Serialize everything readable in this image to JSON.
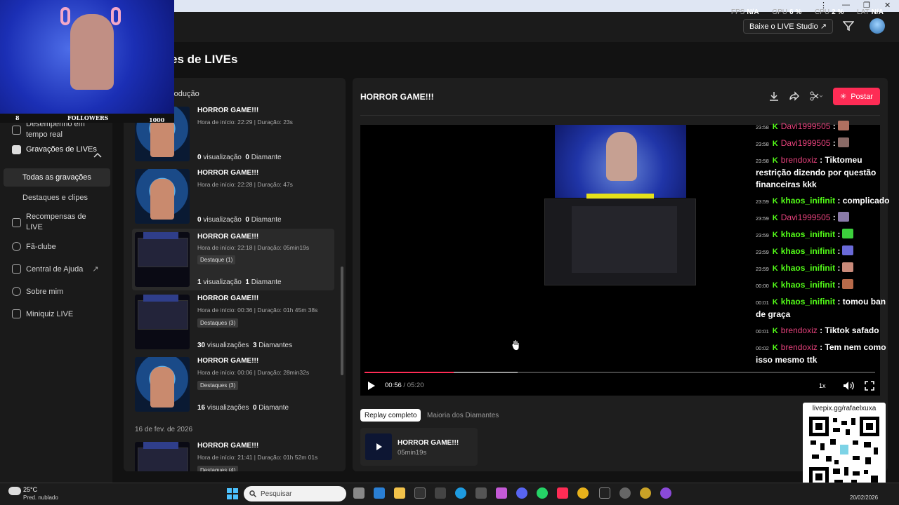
{
  "window": {
    "controls": [
      "⋮",
      "—",
      "❐",
      "✕"
    ]
  },
  "metrics": [
    {
      "label": "FPS",
      "value": "N/A"
    },
    {
      "label": "GPU",
      "value": "6 %"
    },
    {
      "label": "CPU",
      "value": "2 %"
    },
    {
      "label": "LAT",
      "value": "N/A"
    }
  ],
  "header": {
    "studio_button": "Baixe o LIVE Studio ↗"
  },
  "page": {
    "title": "es de LIVEs"
  },
  "sidebar": {
    "items": [
      {
        "label": "Desempenho em tempo real"
      },
      {
        "label": "Gravações de LIVEs"
      },
      {
        "label": "Recompensas de LIVE"
      },
      {
        "label": "Fã-clube"
      },
      {
        "label": "Central de Ajuda"
      },
      {
        "label": "Sobre mim"
      },
      {
        "label": "Miniquiz LIVE"
      }
    ],
    "subitems": [
      {
        "label": "Todas as gravações"
      },
      {
        "label": "Destaques e clipes"
      }
    ]
  },
  "list": {
    "header": "rodução",
    "date_label": "16 de fev. de 2026",
    "recordings": [
      {
        "title": "HORROR GAME!!!",
        "meta": "Hora de início: 22:29 | Duração: 23s",
        "badge": "",
        "views": "0",
        "views_label": "visualização",
        "diamonds": "0",
        "diamonds_label": "Diamante"
      },
      {
        "title": "HORROR GAME!!!",
        "meta": "Hora de início: 22:28 | Duração: 47s",
        "badge": "",
        "views": "0",
        "views_label": "visualização",
        "diamonds": "0",
        "diamonds_label": "Diamante"
      },
      {
        "title": "HORROR GAME!!!",
        "meta": "Hora de início: 22:18 | Duração: 05min19s",
        "badge": "Destaque (1)",
        "views": "1",
        "views_label": "visualização",
        "diamonds": "1",
        "diamonds_label": "Diamante"
      },
      {
        "title": "HORROR GAME!!!",
        "meta": "Hora de início: 00:36 | Duração: 01h 45m 38s",
        "badge": "Destaques (3)",
        "views": "30",
        "views_label": "visualizações",
        "diamonds": "3",
        "diamonds_label": "Diamantes"
      },
      {
        "title": "HORROR GAME!!!",
        "meta": "Hora de início: 00:06 | Duração: 28min32s",
        "badge": "Destaques (3)",
        "views": "16",
        "views_label": "visualizações",
        "diamonds": "0",
        "diamonds_label": "Diamante"
      },
      {
        "title": "HORROR GAME!!!",
        "meta": "Hora de início: 21:41 | Duração: 01h 52m 01s",
        "badge": "Destaques (4)",
        "views": "",
        "views_label": "",
        "diamonds": "",
        "diamonds_label": ""
      }
    ]
  },
  "player": {
    "title": "HORROR GAME!!!",
    "post_button": "Postar",
    "current_time": "00:56",
    "total_time": "05:20",
    "progress_fraction": 0.175,
    "buffered_fraction": 0.3,
    "speed": "1x"
  },
  "chat": [
    {
      "time": "23:58",
      "user": "Davi1999505",
      "user_style": "pink",
      "text": ":",
      "emote": "#b07060"
    },
    {
      "time": "23:58",
      "user": "Davi1999505",
      "user_style": "pink",
      "text": ":",
      "emote": "#8a6a66"
    },
    {
      "time": "23:58",
      "user": "brendoxiz",
      "user_style": "pink",
      "text": ": Tiktomeu restrição dizendo por questão financeiras kkk",
      "emote": ""
    },
    {
      "time": "23:59",
      "user": "khaos_inifinit",
      "user_style": "green",
      "text": ": complicado",
      "emote": ""
    },
    {
      "time": "23:59",
      "user": "Davi1999505",
      "user_style": "pink",
      "text": ":",
      "emote": "#8a7aa8"
    },
    {
      "time": "23:59",
      "user": "khaos_inifinit",
      "user_style": "green",
      "text": ":",
      "emote": "#3ccf3c"
    },
    {
      "time": "23:59",
      "user": "khaos_inifinit",
      "user_style": "green",
      "text": ":",
      "emote": "#6a6ad8"
    },
    {
      "time": "23:59",
      "user": "khaos_inifinit",
      "user_style": "green",
      "text": ":",
      "emote": "#c98a7a"
    },
    {
      "time": "00:00",
      "user": "khaos_inifinit",
      "user_style": "green",
      "text": ":",
      "emote": "#b86a4a"
    },
    {
      "time": "00:01",
      "user": "khaos_inifinit",
      "user_style": "green",
      "text": ": tomou ban de graça",
      "emote": ""
    },
    {
      "time": "00:01",
      "user": "brendoxiz",
      "user_style": "pink",
      "text": ": Tiktok safado",
      "emote": ""
    },
    {
      "time": "00:02",
      "user": "brendoxiz",
      "user_style": "pink",
      "text": ": Tem nem como isso mesmo ttk",
      "emote": ""
    }
  ],
  "tabs": [
    {
      "label": "Replay completo"
    },
    {
      "label": "Maioria dos Diamantes"
    }
  ],
  "replay": {
    "title": "HORROR GAME!!!",
    "duration": "05min19s"
  },
  "qr": {
    "label": "livepix.gg/rafaelxuxa"
  },
  "webcam": {
    "followers_label": "FOLLOWERS",
    "left_count": "8",
    "right_count": "1000"
  },
  "taskbar": {
    "temperature": "25°C",
    "weather": "Pred. nublado",
    "search_placeholder": "Pesquisar",
    "date": "20/02/2026"
  },
  "colors": {
    "accent": "#fe2c55",
    "chat_green": "#53fc18",
    "chat_pink": "#e6427c"
  }
}
